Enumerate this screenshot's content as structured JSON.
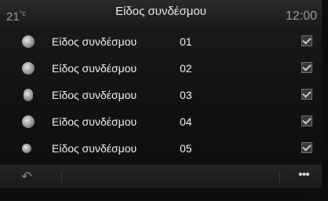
{
  "header": {
    "temperature": "21",
    "temperature_unit": "°c",
    "title": "Είδος συνδέσμου",
    "clock": "12:00"
  },
  "rows": [
    {
      "label": "Είδος συνδέσμου",
      "number": "01",
      "icon": "speaker-cone-icon",
      "checked": true
    },
    {
      "label": "Είδος συνδέσμου",
      "number": "02",
      "icon": "globe-icon",
      "checked": true
    },
    {
      "label": "Είδος συνδέσμου",
      "number": "03",
      "icon": "usb-stick-icon",
      "checked": true
    },
    {
      "label": "Είδος συνδέσμου",
      "number": "04",
      "icon": "media-disc-icon",
      "checked": true
    },
    {
      "label": "Είδος συνδέσμου",
      "number": "05",
      "icon": "phone-icon",
      "checked": true
    }
  ],
  "footer": {
    "back_icon": "back-arrow-icon",
    "back_glyph": "↶",
    "more_icon": "more-options-icon",
    "more_glyph": "•••"
  }
}
